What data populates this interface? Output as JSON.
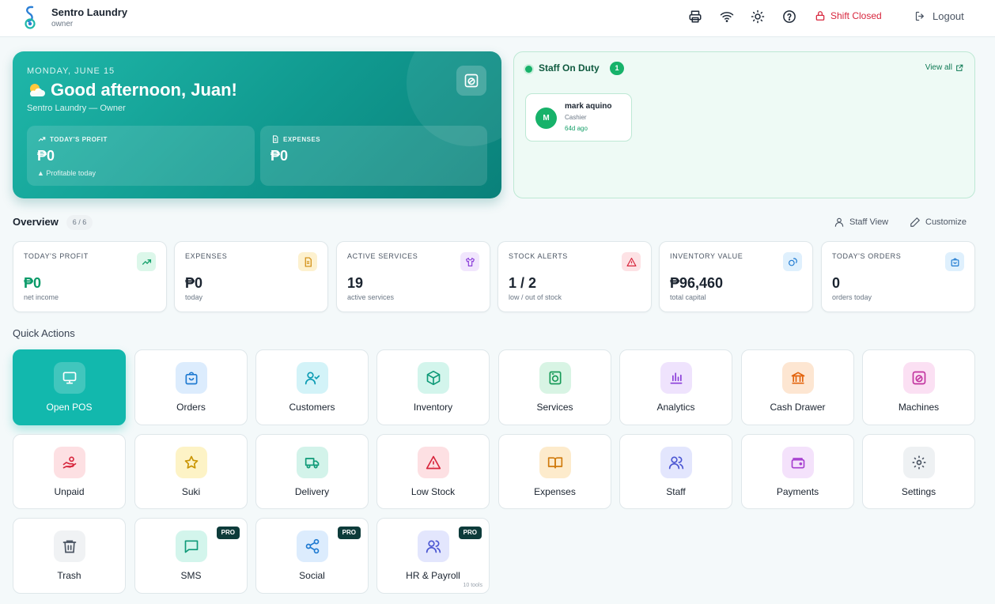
{
  "header": {
    "brand_name": "Sentro Laundry",
    "brand_role": "owner",
    "shift_status": "Shift Closed",
    "logout_label": "Logout",
    "icons": [
      "printer-icon",
      "wifi-icon",
      "sun-icon",
      "help-icon",
      "lock-icon",
      "logout-icon"
    ]
  },
  "hero": {
    "date": "MONDAY, JUNE 15",
    "greeting": "Good afternoon, Juan!",
    "subtitle": "Sentro Laundry — Owner",
    "cards": [
      {
        "label": "TODAY'S PROFIT",
        "value": "₱0",
        "note": "▲ Profitable today"
      },
      {
        "label": "EXPENSES",
        "value": "₱0",
        "note": ""
      }
    ]
  },
  "staff_on_duty": {
    "title": "Staff On Duty",
    "count": "1",
    "view_all": "View all",
    "members": [
      {
        "initial": "M",
        "name": "mark aquino",
        "role": "Cashier",
        "time": "64d ago"
      }
    ]
  },
  "overview": {
    "title": "Overview",
    "badge": "6 / 6",
    "staff_view_label": "Staff View",
    "customize_label": "Customize",
    "stats": [
      {
        "label": "TODAY'S PROFIT",
        "value": "₱0",
        "note": "net income",
        "value_color": "#0a9a68",
        "icon": "trend-up-icon"
      },
      {
        "label": "EXPENSES",
        "value": "₱0",
        "note": "today",
        "value_color": "#1b2430",
        "icon": "receipt-icon"
      },
      {
        "label": "ACTIVE SERVICES",
        "value": "19",
        "note": "active services",
        "value_color": "#1b2430",
        "icon": "shirt-icon"
      },
      {
        "label": "STOCK ALERTS",
        "value": "1 / 2",
        "note": "low / out of stock",
        "value_color": "#1b2430",
        "icon": "alert-icon"
      },
      {
        "label": "INVENTORY VALUE",
        "value": "₱96,460",
        "note": "total capital",
        "value_color": "#1b2430",
        "icon": "coins-icon"
      },
      {
        "label": "TODAY'S ORDERS",
        "value": "0",
        "note": "orders today",
        "value_color": "#1b2430",
        "icon": "bag-icon"
      }
    ]
  },
  "quick_actions": {
    "title": "Quick Actions",
    "items": [
      {
        "label": "Open POS",
        "icon": "monitor-icon"
      },
      {
        "label": "Orders",
        "icon": "bag-icon"
      },
      {
        "label": "Customers",
        "icon": "user-check-icon"
      },
      {
        "label": "Inventory",
        "icon": "box-icon"
      },
      {
        "label": "Services",
        "icon": "washer-icon"
      },
      {
        "label": "Analytics",
        "icon": "bar-chart-icon"
      },
      {
        "label": "Cash Drawer",
        "icon": "bank-icon"
      },
      {
        "label": "Machines",
        "icon": "machine-icon"
      },
      {
        "label": "Unpaid",
        "icon": "hand-coins-icon"
      },
      {
        "label": "Suki",
        "icon": "star-icon"
      },
      {
        "label": "Delivery",
        "icon": "truck-icon"
      },
      {
        "label": "Low Stock",
        "icon": "alert-icon"
      },
      {
        "label": "Expenses",
        "icon": "book-icon"
      },
      {
        "label": "Staff",
        "icon": "users-icon"
      },
      {
        "label": "Payments",
        "icon": "wallet-icon"
      },
      {
        "label": "Settings",
        "icon": "gear-icon"
      },
      {
        "label": "Trash",
        "icon": "trash-icon"
      },
      {
        "label": "SMS",
        "icon": "message-icon",
        "badge": "PRO"
      },
      {
        "label": "Social",
        "icon": "share-icon",
        "badge": "PRO"
      },
      {
        "label": "HR & Payroll",
        "icon": "users-icon",
        "badge": "PRO",
        "sub": "10 tools"
      }
    ]
  },
  "colors": {
    "accent": "#12b8ad",
    "danger": "#d7263d",
    "success": "#17b26a"
  }
}
